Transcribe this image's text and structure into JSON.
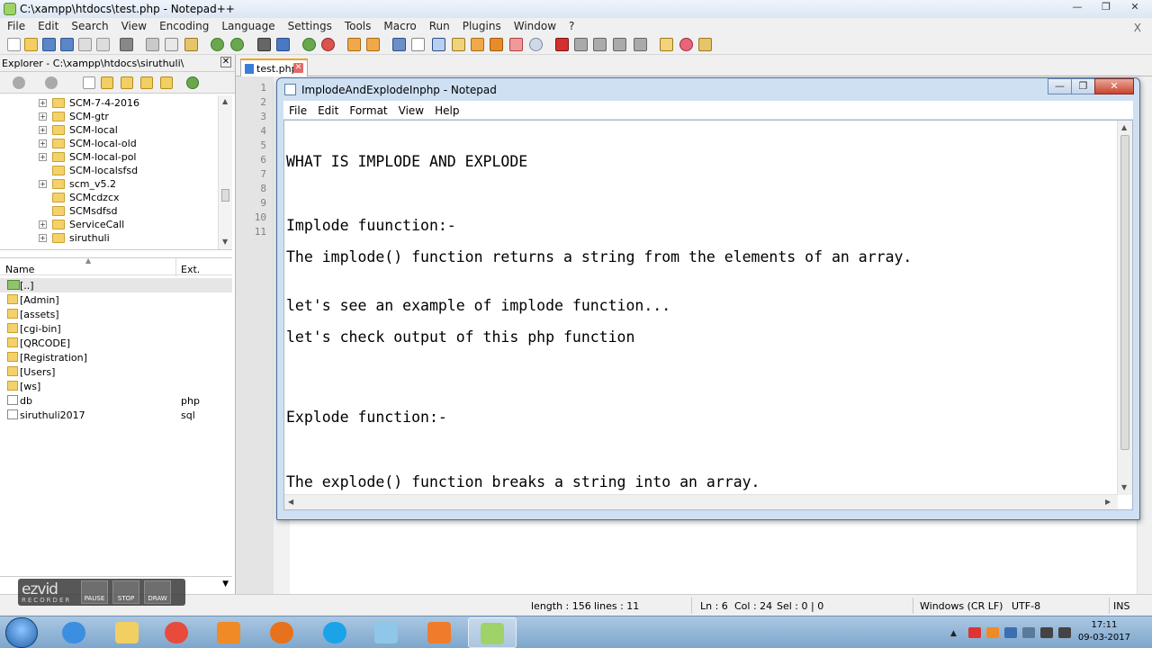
{
  "npp": {
    "title": "C:\\xampp\\htdocs\\test.php - Notepad++",
    "menu": [
      "File",
      "Edit",
      "Search",
      "View",
      "Encoding",
      "Language",
      "Settings",
      "Tools",
      "Macro",
      "Run",
      "Plugins",
      "Window",
      "?"
    ],
    "menu_close": "X"
  },
  "explorer": {
    "path": "Explorer - C:\\xampp\\htdocs\\siruthuli\\",
    "tree": [
      {
        "label": "SCM-7-4-2016",
        "expandable": true
      },
      {
        "label": "SCM-gtr",
        "expandable": true
      },
      {
        "label": "SCM-local",
        "expandable": true
      },
      {
        "label": "SCM-local-old",
        "expandable": true
      },
      {
        "label": "SCM-local-pol",
        "expandable": true
      },
      {
        "label": "SCM-localsfsd",
        "expandable": false
      },
      {
        "label": "scm_v5.2",
        "expandable": true
      },
      {
        "label": "SCMcdzcx",
        "expandable": false
      },
      {
        "label": "SCMsdfsd",
        "expandable": false
      },
      {
        "label": "ServiceCall",
        "expandable": true
      },
      {
        "label": "siruthuli",
        "expandable": true
      }
    ],
    "col_name": "Name",
    "col_ext": "Ext.",
    "files": [
      {
        "name": "[..]",
        "ext": "",
        "kind": "up"
      },
      {
        "name": "[Admin]",
        "ext": "",
        "kind": "folder"
      },
      {
        "name": "[assets]",
        "ext": "",
        "kind": "folder"
      },
      {
        "name": "[cgi-bin]",
        "ext": "",
        "kind": "folder"
      },
      {
        "name": "[QRCODE]",
        "ext": "",
        "kind": "folder"
      },
      {
        "name": "[Registration]",
        "ext": "",
        "kind": "folder"
      },
      {
        "name": "[Users]",
        "ext": "",
        "kind": "folder"
      },
      {
        "name": "[ws]",
        "ext": "",
        "kind": "folder"
      },
      {
        "name": "db",
        "ext": "php",
        "kind": "doc"
      },
      {
        "name": "siruthuli2017",
        "ext": "sql",
        "kind": "doc"
      }
    ]
  },
  "tab": {
    "label": "test.php",
    "close": "✕"
  },
  "gutter_lines": [
    "1",
    "2",
    "3",
    "4",
    "5",
    "6",
    "7",
    "8",
    "9",
    "10",
    "11"
  ],
  "status": {
    "length": "length : 156",
    "lines": "lines : 11",
    "ln": "Ln : 6",
    "col": "Col : 24",
    "sel": "Sel : 0 | 0",
    "eol": "Windows (CR LF)",
    "encoding": "UTF-8",
    "ins": "INS"
  },
  "ezvid": {
    "logo": "ezvid",
    "sub": "RECORDER",
    "pause": "PAUSE",
    "stop": "STOP",
    "draw": "DRAW"
  },
  "notepad": {
    "title": "ImplodeAndExplodeInphp - Notepad",
    "menu": [
      "File",
      "Edit",
      "Format",
      "View",
      "Help"
    ],
    "lines": [
      "WHAT IS IMPLODE AND EXPLODE",
      "Implode fuunction:-",
      "The implode() function returns a string from the elements of an array.",
      "let's see an example of implode function...",
      "let's check output of this php function",
      "Explode function:-",
      "The explode() function breaks a string into an array."
    ]
  },
  "taskbar": {
    "time": "17:11",
    "date": "09-03-2017"
  }
}
